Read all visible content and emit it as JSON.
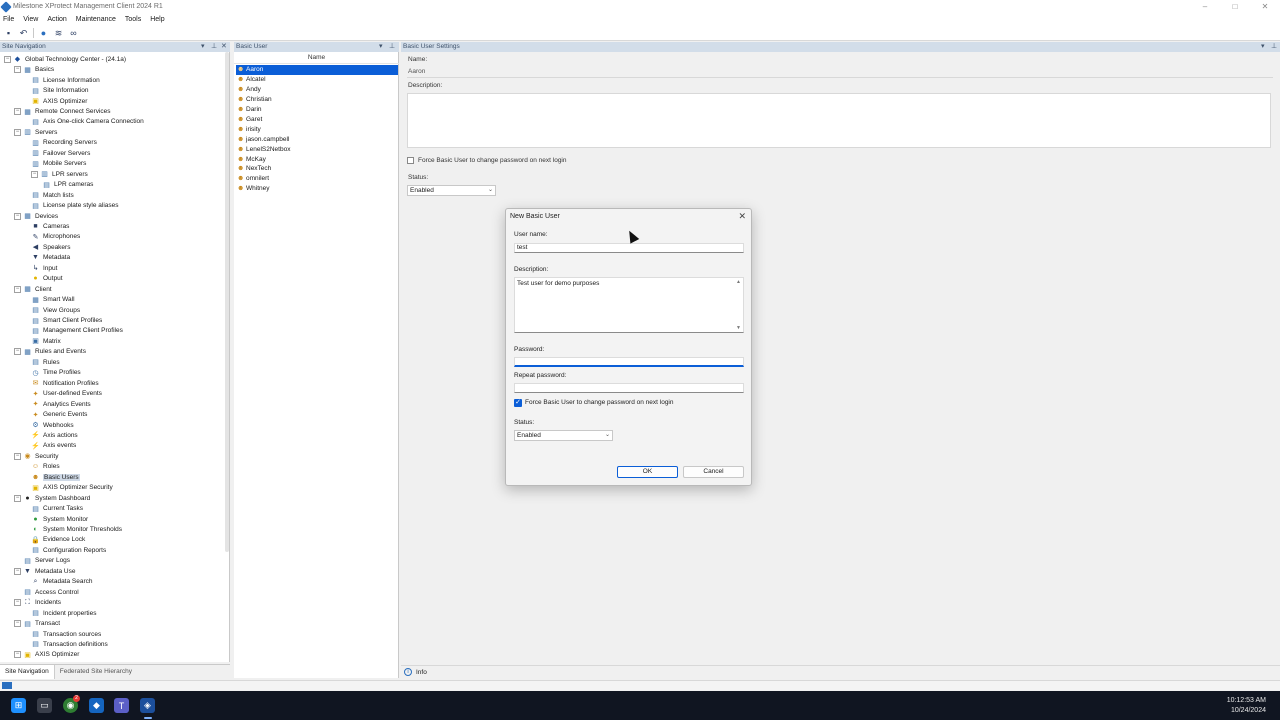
{
  "window": {
    "title": "Milestone XProtect Management Client 2024 R1",
    "controls": [
      "–",
      "□",
      "✕"
    ]
  },
  "menu": [
    "File",
    "View",
    "Action",
    "Maintenance",
    "Tools",
    "Help"
  ],
  "toolbar_icons": [
    "save-icon",
    "undo-icon",
    "help-icon",
    "refresh-icon",
    "binoculars-icon"
  ],
  "nav": {
    "header": "Site Navigation",
    "tabs": [
      "Site Navigation",
      "Federated Site Hierarchy"
    ],
    "items": [
      {
        "label": "Global Technology Center - (24.1a)",
        "level": 0,
        "toggle": "−",
        "icon": "server-icon",
        "sym": "◆",
        "color": "#1c4f9c"
      },
      {
        "label": "Basics",
        "level": 1,
        "toggle": "−",
        "icon": "basics-icon",
        "sym": "▦",
        "color": "#3a6ea5"
      },
      {
        "label": "License Information",
        "level": 2,
        "icon": "license-icon",
        "sym": "▤",
        "color": "#3a6ea5"
      },
      {
        "label": "Site Information",
        "level": 2,
        "icon": "site-info-icon",
        "sym": "▤",
        "color": "#3a6ea5"
      },
      {
        "label": "AXIS Optimizer",
        "level": 2,
        "icon": "axis-optimizer-icon",
        "sym": "▣",
        "color": "#e2b400"
      },
      {
        "label": "Remote Connect Services",
        "level": 1,
        "toggle": "−",
        "icon": "remote-connect-icon",
        "sym": "▦",
        "color": "#3a6ea5"
      },
      {
        "label": "Axis One-click Camera Connection",
        "level": 2,
        "icon": "camera-connection-icon",
        "sym": "▤",
        "color": "#3a6ea5"
      },
      {
        "label": "Servers",
        "level": 1,
        "toggle": "−",
        "icon": "servers-icon",
        "sym": "▥",
        "color": "#3a6ea5"
      },
      {
        "label": "Recording Servers",
        "level": 2,
        "icon": "recording-server-icon",
        "sym": "▥",
        "color": "#3a6ea5"
      },
      {
        "label": "Failover Servers",
        "level": 2,
        "icon": "failover-server-icon",
        "sym": "▥",
        "color": "#3a6ea5"
      },
      {
        "label": "Mobile Servers",
        "level": 2,
        "icon": "mobile-server-icon",
        "sym": "▥",
        "color": "#3a6ea5"
      },
      {
        "label": "LPR servers",
        "level": 2,
        "toggle": "−",
        "icon": "lpr-server-icon",
        "sym": "▥",
        "color": "#3a6ea5"
      },
      {
        "label": "LPR cameras",
        "level": 3,
        "icon": "lpr-camera-icon",
        "sym": "▤",
        "color": "#3a6ea5"
      },
      {
        "label": "Match lists",
        "level": 2,
        "icon": "match-list-icon",
        "sym": "▤",
        "color": "#3a6ea5"
      },
      {
        "label": "License plate style aliases",
        "level": 2,
        "icon": "plate-alias-icon",
        "sym": "▤",
        "color": "#3a6ea5"
      },
      {
        "label": "Devices",
        "level": 1,
        "toggle": "−",
        "icon": "devices-icon",
        "sym": "▦",
        "color": "#3a6ea5"
      },
      {
        "label": "Cameras",
        "level": 2,
        "icon": "camera-icon",
        "sym": "■",
        "color": "#2d3f63"
      },
      {
        "label": "Microphones",
        "level": 2,
        "icon": "microphone-icon",
        "sym": "✎",
        "color": "#2d3f63"
      },
      {
        "label": "Speakers",
        "level": 2,
        "icon": "speaker-icon",
        "sym": "◀",
        "color": "#2d3f63"
      },
      {
        "label": "Metadata",
        "level": 2,
        "icon": "metadata-icon",
        "sym": "▼",
        "color": "#2d3f63"
      },
      {
        "label": "Input",
        "level": 2,
        "icon": "input-icon",
        "sym": "↳",
        "color": "#2d3f63"
      },
      {
        "label": "Output",
        "level": 2,
        "icon": "output-icon",
        "sym": "●",
        "color": "#e2b400"
      },
      {
        "label": "Client",
        "level": 1,
        "toggle": "−",
        "icon": "client-icon",
        "sym": "▦",
        "color": "#3a6ea5"
      },
      {
        "label": "Smart Wall",
        "level": 2,
        "icon": "smart-wall-icon",
        "sym": "▦",
        "color": "#3a6ea5"
      },
      {
        "label": "View Groups",
        "level": 2,
        "icon": "view-groups-icon",
        "sym": "▤",
        "color": "#3a6ea5"
      },
      {
        "label": "Smart Client Profiles",
        "level": 2,
        "icon": "smart-client-profile-icon",
        "sym": "▤",
        "color": "#3a6ea5"
      },
      {
        "label": "Management Client Profiles",
        "level": 2,
        "icon": "management-profile-icon",
        "sym": "▤",
        "color": "#3a6ea5"
      },
      {
        "label": "Matrix",
        "level": 2,
        "icon": "matrix-icon",
        "sym": "▣",
        "color": "#3a6ea5"
      },
      {
        "label": "Rules and Events",
        "level": 1,
        "toggle": "−",
        "icon": "rules-events-icon",
        "sym": "▦",
        "color": "#3a6ea5"
      },
      {
        "label": "Rules",
        "level": 2,
        "icon": "rules-icon",
        "sym": "▤",
        "color": "#3a6ea5"
      },
      {
        "label": "Time Profiles",
        "level": 2,
        "icon": "time-profile-icon",
        "sym": "◷",
        "color": "#3a6ea5"
      },
      {
        "label": "Notification Profiles",
        "level": 2,
        "icon": "notification-icon",
        "sym": "✉",
        "color": "#c98a1c"
      },
      {
        "label": "User-defined Events",
        "level": 2,
        "icon": "user-event-icon",
        "sym": "✦",
        "color": "#c98a1c"
      },
      {
        "label": "Analytics Events",
        "level": 2,
        "icon": "analytics-icon",
        "sym": "✦",
        "color": "#c98a1c"
      },
      {
        "label": "Generic Events",
        "level": 2,
        "icon": "generic-event-icon",
        "sym": "✦",
        "color": "#c98a1c"
      },
      {
        "label": "Webhooks",
        "level": 2,
        "icon": "webhook-icon",
        "sym": "⚙",
        "color": "#3a6ea5"
      },
      {
        "label": "Axis actions",
        "level": 2,
        "icon": "axis-action-icon",
        "sym": "⚡",
        "color": "#2d3f63"
      },
      {
        "label": "Axis events",
        "level": 2,
        "icon": "axis-event-icon",
        "sym": "⚡",
        "color": "#2d3f63"
      },
      {
        "label": "Security",
        "level": 1,
        "toggle": "−",
        "icon": "security-icon",
        "sym": "◉",
        "color": "#c98a1c"
      },
      {
        "label": "Roles",
        "level": 2,
        "icon": "roles-icon",
        "sym": "☺",
        "color": "#c98a1c"
      },
      {
        "label": "Basic Users",
        "level": 2,
        "icon": "basic-users-icon",
        "sym": "☻",
        "color": "#c98a1c",
        "selected": true
      },
      {
        "label": "AXIS Optimizer Security",
        "level": 2,
        "icon": "optimizer-security-icon",
        "sym": "▣",
        "color": "#e2b400"
      },
      {
        "label": "System Dashboard",
        "level": 1,
        "toggle": "−",
        "icon": "dashboard-icon",
        "sym": "●",
        "color": "#222222"
      },
      {
        "label": "Current Tasks",
        "level": 2,
        "icon": "tasks-icon",
        "sym": "▤",
        "color": "#3a6ea5"
      },
      {
        "label": "System Monitor",
        "level": 2,
        "icon": "system-monitor-icon",
        "sym": "●",
        "color": "#2e9b3e"
      },
      {
        "label": "System Monitor Thresholds",
        "level": 2,
        "icon": "thresholds-icon",
        "sym": "◐",
        "color": "#2e9b3e"
      },
      {
        "label": "Evidence Lock",
        "level": 2,
        "icon": "evidence-lock-icon",
        "sym": "🔒",
        "color": "#c98a1c"
      },
      {
        "label": "Configuration Reports",
        "level": 2,
        "icon": "reports-icon",
        "sym": "▤",
        "color": "#3a6ea5"
      },
      {
        "label": "Server Logs",
        "level": 1,
        "icon": "server-logs-icon",
        "sym": "▤",
        "color": "#3a6ea5"
      },
      {
        "label": "Metadata Use",
        "level": 1,
        "toggle": "−",
        "icon": "metadata-use-icon",
        "sym": "▼",
        "color": "#2d3f63"
      },
      {
        "label": "Metadata Search",
        "level": 2,
        "icon": "metadata-search-icon",
        "sym": "⌕",
        "color": "#2d3f63"
      },
      {
        "label": "Access Control",
        "level": 1,
        "icon": "access-control-icon",
        "sym": "▤",
        "color": "#3a6ea5"
      },
      {
        "label": "Incidents",
        "level": 1,
        "toggle": "−",
        "icon": "incidents-icon",
        "sym": "⛶",
        "color": "#2d3f63"
      },
      {
        "label": "Incident properties",
        "level": 2,
        "icon": "incident-properties-icon",
        "sym": "▤",
        "color": "#3a6ea5"
      },
      {
        "label": "Transact",
        "level": 1,
        "toggle": "−",
        "icon": "transact-icon",
        "sym": "▤",
        "color": "#3a6ea5"
      },
      {
        "label": "Transaction sources",
        "level": 2,
        "icon": "transaction-source-icon",
        "sym": "▤",
        "color": "#3a6ea5"
      },
      {
        "label": "Transaction definitions",
        "level": 2,
        "icon": "transaction-definition-icon",
        "sym": "▤",
        "color": "#3a6ea5"
      },
      {
        "label": "AXIS Optimizer",
        "level": 1,
        "toggle": "−",
        "icon": "axis-optimizer-icon",
        "sym": "▣",
        "color": "#e2b400"
      }
    ]
  },
  "users_panel": {
    "header": "Basic User",
    "column": "Name",
    "users": [
      "Aaron",
      "Alcatel",
      "Andy",
      "Christian",
      "Darin",
      "Garet",
      "irisity",
      "jason.campbell",
      "LenelS2Netbox",
      "McKay",
      "NexTech",
      "omnilert",
      "Whitney"
    ],
    "selected": "Aaron"
  },
  "settings": {
    "header": "Basic User Settings",
    "name_label": "Name:",
    "name_value": "Aaron",
    "description_label": "Description:",
    "force_label": "Force Basic User to change password on next login",
    "status_label": "Status:",
    "status_value": "Enabled"
  },
  "info_bar": {
    "label": "Info"
  },
  "dialog": {
    "title": "New Basic User",
    "close": "✕",
    "username_label": "User name:",
    "username_value": "test",
    "description_label": "Description:",
    "description_value": "Test user for demo purposes",
    "password_label": "Password:",
    "password_value": "",
    "repeat_label": "Repeat password:",
    "repeat_value": "",
    "force_label": "Force Basic User to change password on next login",
    "force_checked": true,
    "status_label": "Status:",
    "status_value": "Enabled",
    "ok": "OK",
    "cancel": "Cancel"
  },
  "taskbar": {
    "time": "10:12:53 AM",
    "date": "10/24/2024",
    "apps": [
      "windows-start-icon",
      "file-explorer-icon",
      "chrome-icon",
      "xprotect-smart-client-icon",
      "teams-icon",
      "xprotect-management-client-icon"
    ],
    "chrome_badge": "2"
  }
}
